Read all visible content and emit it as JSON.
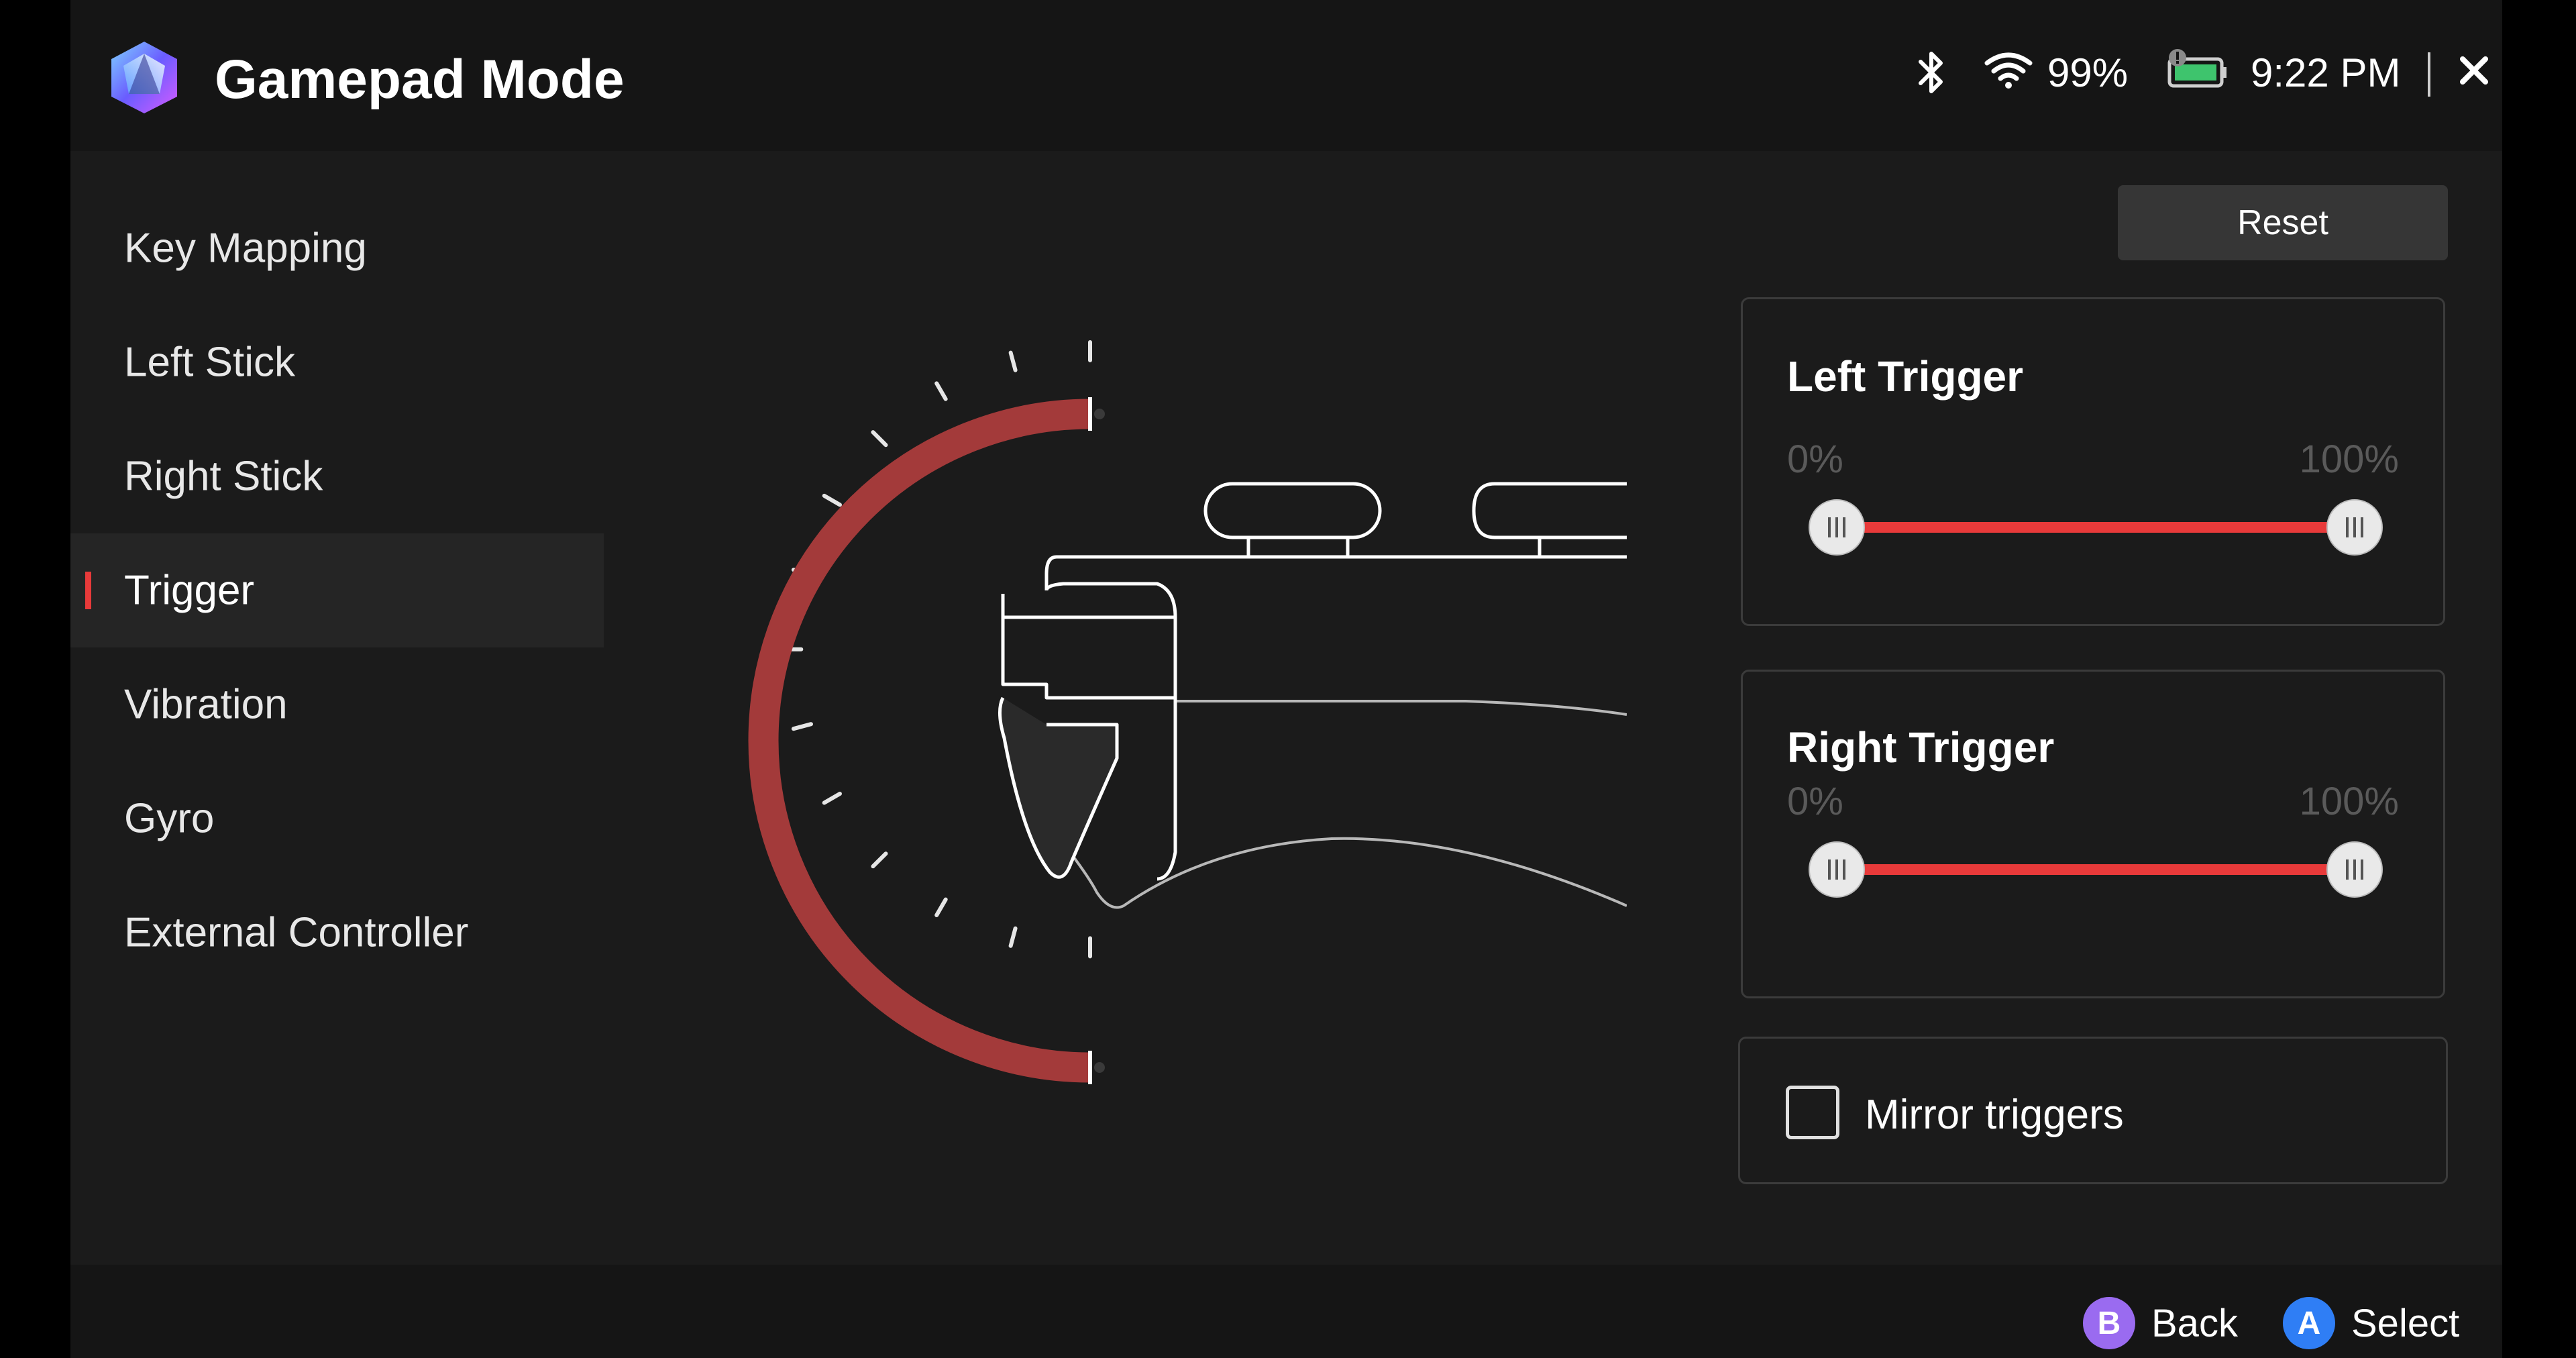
{
  "app": {
    "title": "Gamepad Mode"
  },
  "status": {
    "bluetooth_icon": "bluetooth-icon",
    "wifi_icon": "wifi-icon",
    "battery_percent": "99%",
    "battery_icon": "battery-charging-icon",
    "time": "9:22 PM",
    "close_icon": "close-icon"
  },
  "sidebar": {
    "items": [
      {
        "label": "Key Mapping"
      },
      {
        "label": "Left Stick"
      },
      {
        "label": "Right Stick"
      },
      {
        "label": "Trigger"
      },
      {
        "label": "Vibration"
      },
      {
        "label": "Gyro"
      },
      {
        "label": "External Controller"
      }
    ],
    "active_index": 3
  },
  "toolbar": {
    "reset_label": "Reset"
  },
  "triggers": {
    "left": {
      "title": "Left Trigger",
      "min_label": "0%",
      "max_label": "100%",
      "range_start": 0,
      "range_end": 100
    },
    "right": {
      "title": "Right Trigger",
      "min_label": "0%",
      "max_label": "100%",
      "range_start": 0,
      "range_end": 100
    }
  },
  "mirror": {
    "label": "Mirror triggers",
    "checked": false
  },
  "footer": {
    "back_key": "B",
    "back_label": "Back",
    "select_key": "A",
    "select_label": "Select"
  },
  "colors": {
    "accent": "#e83a3a",
    "arc": "#a33a3a",
    "back_badge": "#9a6bf0",
    "select_badge": "#2f7ef5",
    "background": "#1b1b1b"
  }
}
